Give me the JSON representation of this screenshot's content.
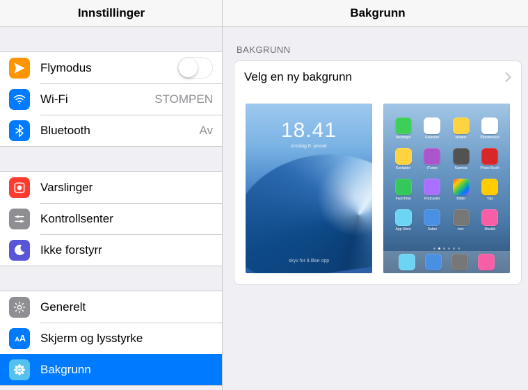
{
  "sidebar": {
    "title": "Innstillinger",
    "groups": [
      [
        {
          "key": "airplane",
          "label": "Flymodus",
          "icon": "airplane",
          "bg": "#ff9500",
          "type": "toggle",
          "on": false
        },
        {
          "key": "wifi",
          "label": "Wi-Fi",
          "value": "STOMPEN",
          "icon": "wifi",
          "bg": "#007aff"
        },
        {
          "key": "bluetooth",
          "label": "Bluetooth",
          "value": "Av",
          "icon": "bluetooth",
          "bg": "#007aff"
        }
      ],
      [
        {
          "key": "notifications",
          "label": "Varslinger",
          "icon": "notification",
          "bg": "#ff3b30"
        },
        {
          "key": "controlcenter",
          "label": "Kontrollsenter",
          "icon": "controls",
          "bg": "#8e8e93"
        },
        {
          "key": "dnd",
          "label": "Ikke forstyrr",
          "icon": "moon",
          "bg": "#5856d6"
        }
      ],
      [
        {
          "key": "general",
          "label": "Generelt",
          "icon": "gear",
          "bg": "#8e8e93"
        },
        {
          "key": "display",
          "label": "Skjerm og lysstyrke",
          "icon": "text-size",
          "bg": "#007aff"
        },
        {
          "key": "wallpaper",
          "label": "Bakgrunn",
          "icon": "flower",
          "bg": "#55c1ef",
          "selected": true
        }
      ]
    ]
  },
  "content": {
    "title": "Bakgrunn",
    "section_label": "BAKGRUNN",
    "choose_label": "Velg en ny bakgrunn",
    "lock_preview": {
      "time": "18.41",
      "date": "onsdag 8. januar",
      "unlock": "skyv for å låse opp"
    },
    "home_preview": {
      "dock": [
        "#6dd5f4",
        "#4a90e2",
        "#777777",
        "#f85ea5"
      ],
      "apps": [
        {
          "c": "#3ecf5a",
          "n": "Meldinger"
        },
        {
          "c": "#ffffff",
          "n": "Kalender"
        },
        {
          "c": "#ffd23f",
          "n": "Notater"
        },
        {
          "c": "#ffffff",
          "n": "Påminnelser"
        },
        {
          "c": "#ffd23f",
          "n": "Kontakter"
        },
        {
          "c": "#aa55cc",
          "n": "iTunes"
        },
        {
          "c": "#525252",
          "n": "Kamera"
        },
        {
          "c": "#d92626",
          "n": "Photo Booth"
        },
        {
          "c": "#34c759",
          "n": "FaceTime"
        },
        {
          "c": "#a970ff",
          "n": "Podcaster"
        },
        {
          "c": "linear-gradient(135deg,#ff3b30,#ffcc00,#34c759,#007aff,#af52de)",
          "n": "Bilder"
        },
        {
          "c": "#ffcc00",
          "n": "Tips"
        },
        {
          "c": "#6dd5f4",
          "n": "App Store"
        },
        {
          "c": "#4a90e2",
          "n": "Safari"
        },
        {
          "c": "#777777",
          "n": "Inst."
        },
        {
          "c": "#f85ea5",
          "n": "Musikk"
        }
      ]
    }
  }
}
